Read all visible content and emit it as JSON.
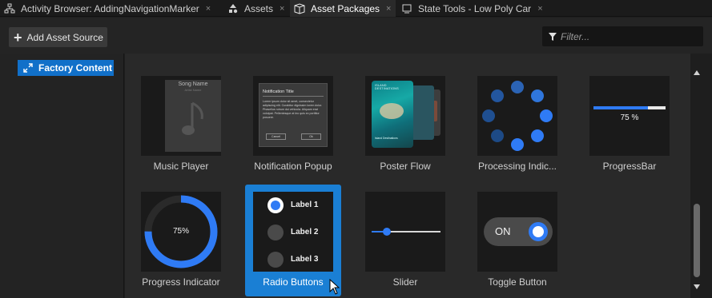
{
  "tabs": [
    {
      "label": "Activity Browser: AddingNavigationMarker",
      "icon": "hierarchy-icon",
      "active": false
    },
    {
      "label": "Assets",
      "icon": "shapes-icon",
      "active": false
    },
    {
      "label": "Asset Packages",
      "icon": "package-icon",
      "active": true
    },
    {
      "label": "State Tools - Low Poly Car",
      "icon": "monitor-icon",
      "active": false
    }
  ],
  "tab_close_glyph": "×",
  "toolbar": {
    "add_label": "Add Asset Source",
    "filter_placeholder": "Filter..."
  },
  "tree": {
    "selected_item": "Factory Content"
  },
  "cards": [
    {
      "label": "Music Player",
      "thumb": {
        "title": "Song Name",
        "subtitle": "Artist Name"
      }
    },
    {
      "label": "Notification Popup",
      "thumb": {
        "title": "Notification Title",
        "body": "Lorem ipsum dolor sit amet, consectetur adipiscing elit. Curabitur dignissim lorem dolor. Phasellus rutrum dui vehicula. Aliquam erat volutpat. Pellentesque at leo quis ex porttitor posuere.",
        "cancel": "Cancel",
        "ok": "Ok"
      }
    },
    {
      "label": "Poster Flow",
      "thumb": {
        "title": "ISLAND DESTINATIONS",
        "caption": "Island Destinations"
      }
    },
    {
      "label": "Processing Indic...",
      "thumb": {}
    },
    {
      "label": "ProgressBar",
      "thumb": {
        "value_text": "75 %",
        "progress": 0.75
      }
    },
    {
      "label": "Progress Indicator",
      "thumb": {
        "value_text": "75%",
        "progress": 0.75
      }
    },
    {
      "label": "Radio Buttons",
      "thumb": {
        "options": [
          "Label 1",
          "Label 2",
          "Label 3"
        ],
        "selected_index": 0
      }
    },
    {
      "label": "Slider",
      "thumb": {
        "value": 0.22
      }
    },
    {
      "label": "Toggle Button",
      "thumb": {
        "state_text": "ON"
      }
    }
  ],
  "selected_card": "Radio Buttons",
  "colors": {
    "accent": "#1a7fd4",
    "tree_selected": "#1170c9",
    "progress_blue": "#2f7bf5"
  }
}
